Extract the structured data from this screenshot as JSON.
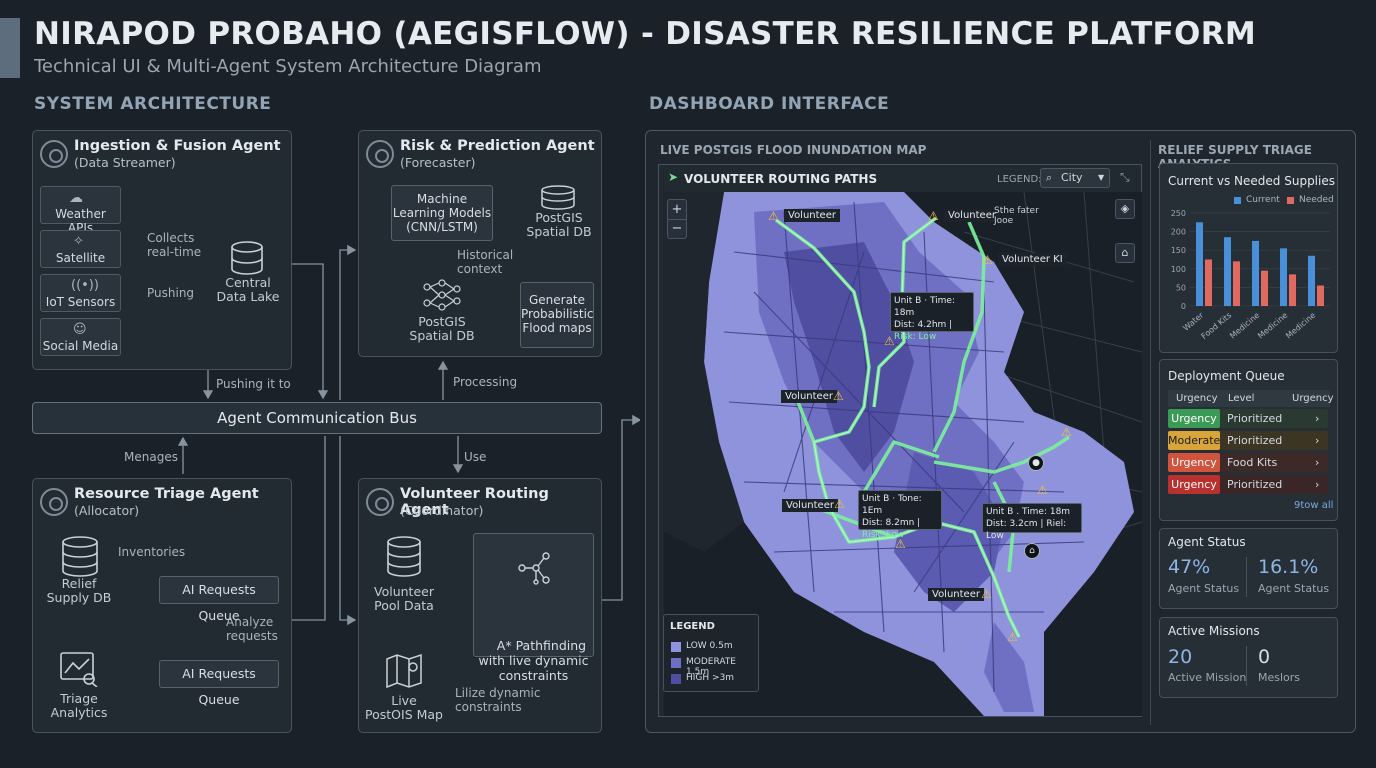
{
  "header": {
    "title": "NIRAPOD PROBAHO (AEGISFLOW) - DISASTER RESILIENCE PLATFORM",
    "subtitle": "Technical UI & Multi-Agent System Architecture Diagram"
  },
  "arch": {
    "section": "SYSTEM ARCHITECTURE",
    "ingestion": {
      "title": "Ingestion & Fusion Agent",
      "sub": "(Data Streamer)",
      "sources": [
        "Weather APIs",
        "Satellite",
        "IoT Sensors",
        "Social Media"
      ],
      "collects": "Collects\nreal-time",
      "pushing": "Pushing",
      "lake": "Central\nData Lake"
    },
    "risk": {
      "title": "Risk & Prediction Agent",
      "sub": "(Forecaster)",
      "ml": "Machine\nLearning Models\n(CNN/LSTM)",
      "postgis_top": "PostGIS\nSpatial DB",
      "historical": "Historical\ncontext",
      "postgis_bottom": "PostGIS\nSpatial DB",
      "generate": "Generate\nProbabilistic\nFlood maps"
    },
    "bus": "Agent Communication Bus",
    "pushing_it": "Pushing it to",
    "processing": "Processing",
    "menages": "Menages",
    "use": "Use",
    "triage": {
      "title": "Resource Triage Agent",
      "sub": "(Allocator)",
      "relief": "Relief\nSupply DB",
      "inventories": "Inventories",
      "queue1": "AI Requests Queue",
      "analyze": "Analyze\nrequests",
      "queue2": "AI Requests Queue",
      "analytics": "Triage\nAnalytics"
    },
    "routing": {
      "title": "Volunteer Routing Agent",
      "sub": "(Coordinator)",
      "pool": "Volunteer\nPool Data",
      "astar": "A* Pathfinding\nwith live dynamic\nconstraints",
      "live": "Live\nPostOIS Map",
      "lilize": "Lilize dynamic\nconstraints"
    }
  },
  "dash": {
    "section": "DASHBOARD INTERFACE",
    "map_title": "LIVE POSTGIS FLOOD INUNDATION MAP",
    "routing_title": "VOLUNTEER ROUTING PATHS",
    "legend_label": "LEGEND:",
    "city": "City",
    "zoom_in": "+",
    "zoom_out": "−",
    "volunteer_tags": [
      "Volunteer",
      "Volunteer",
      "Volunteer KI",
      "Volunteer",
      "Volunteer",
      "Volunteer"
    ],
    "street_tag": "Sthe fater\nJooe",
    "info1": [
      "Unit B · Time: 18m",
      "Dist: 4.2hm |",
      "Risk: Low"
    ],
    "info2": [
      "Unit B · Tone: 1Em",
      "Dist: 8.2mn |",
      "Risk: Low"
    ],
    "info3": [
      "Unit B . Time: 18m",
      "Dist: 3.2cm | Riel: Low"
    ],
    "legend": {
      "title": "LEGEND",
      "items": [
        {
          "label": "LOW 0.5m",
          "color": "#8e93dc"
        },
        {
          "label": "MODERATE 1.5m",
          "color": "#6f6fc4"
        },
        {
          "label": "HIGH >3m",
          "color": "#4f4ea0"
        }
      ]
    },
    "relief_title": "RELIEF SUPPLY TRIAGE ANALYTICS",
    "supplies": {
      "title": "Current vs Needed Supplies",
      "legend": [
        "Current",
        "Needed"
      ]
    },
    "queue": {
      "title": "Deployment Queue",
      "headers": [
        "Urgency",
        "Level",
        "Urgency"
      ],
      "rows": [
        {
          "tag": "Urgency",
          "level": "Prioritized",
          "color": "#3c9a57"
        },
        {
          "tag": "Moderate",
          "level": "Prioritized",
          "color": "#d7a53a"
        },
        {
          "tag": "Urgency",
          "level": "Food Kits",
          "color": "#d0533d"
        },
        {
          "tag": "Urgency",
          "level": "Prioritized",
          "color": "#b8312f"
        }
      ],
      "view_all": "9tow all"
    },
    "status": {
      "title": "Agent Status",
      "v1": "47%",
      "l1": "Agent Status",
      "v2": "16.1%",
      "l2": "Agent Status"
    },
    "missions": {
      "title": "Active Missions",
      "v1": "20",
      "l1": "Active Mission",
      "v2": "0",
      "l2": "Meslors"
    },
    "colors": {
      "route": "#7cf29a",
      "current": "#4a90d9",
      "needed": "#e06a5f",
      "flood_low": "#8e93dc",
      "flood_high": "#4f4ea0"
    }
  },
  "chart_data": {
    "type": "bar",
    "title": "Current vs Needed Supplies",
    "categories": [
      "Water",
      "Food Kits",
      "Medicine",
      "Medicine",
      "Medicine"
    ],
    "series": [
      {
        "name": "Current",
        "values": [
          225,
          185,
          175,
          155,
          135
        ]
      },
      {
        "name": "Needed",
        "values": [
          125,
          120,
          95,
          85,
          55
        ]
      }
    ],
    "ylim": [
      0,
      250
    ],
    "yticks": [
      0,
      50,
      100,
      150,
      200,
      250
    ],
    "legend": "top-right"
  }
}
